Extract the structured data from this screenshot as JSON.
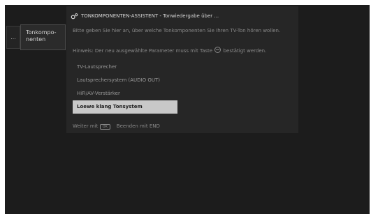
{
  "left_strip": {
    "label": "..."
  },
  "side_menu": {
    "label": "Tonkompo-\nnenten"
  },
  "dialog": {
    "title": "TONKOMPONENTEN-ASSISTENT - Tonwiedergabe über ...",
    "title_icon": "gear-icon",
    "description": "Bitte geben Sie hier an, über welche Tonkomponenten Sie Ihren TV-Ton hören wollen.",
    "hint_prefix": "Hinweis: Der neu ausgewählte Parameter muss mit Taste",
    "hint_suffix": "bestätigt werden.",
    "options": [
      {
        "label": "TV-Lautsprecher",
        "selected": false
      },
      {
        "label": "Lautsprechersystem (AUDIO OUT)",
        "selected": false
      },
      {
        "label": "HiFi/AV-Verstärker",
        "selected": false
      },
      {
        "label": "Loewe klang Tonsystem",
        "selected": true
      }
    ],
    "footer": {
      "next_label": "Weiter mit",
      "next_key": "OK",
      "end_label": "Beenden mit",
      "end_key": "END"
    }
  }
}
